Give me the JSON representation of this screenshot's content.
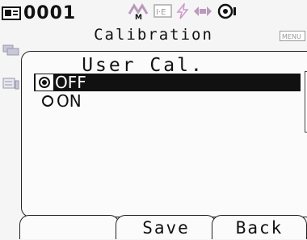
{
  "status": {
    "measurement_id": "0001",
    "icons": [
      "card-icon",
      "measure-mode-icon",
      "ie-icon",
      "lightning-icon",
      "connection-icon",
      "battery-icon"
    ]
  },
  "screen": {
    "title": "Calibration",
    "menu_tag": "MENU"
  },
  "dialog": {
    "title": "User Cal.",
    "options": [
      {
        "label": "OFF",
        "selected": true
      },
      {
        "label": "ON",
        "selected": false
      }
    ]
  },
  "softkeys": {
    "left": "",
    "middle": "Save",
    "right": "Back"
  }
}
